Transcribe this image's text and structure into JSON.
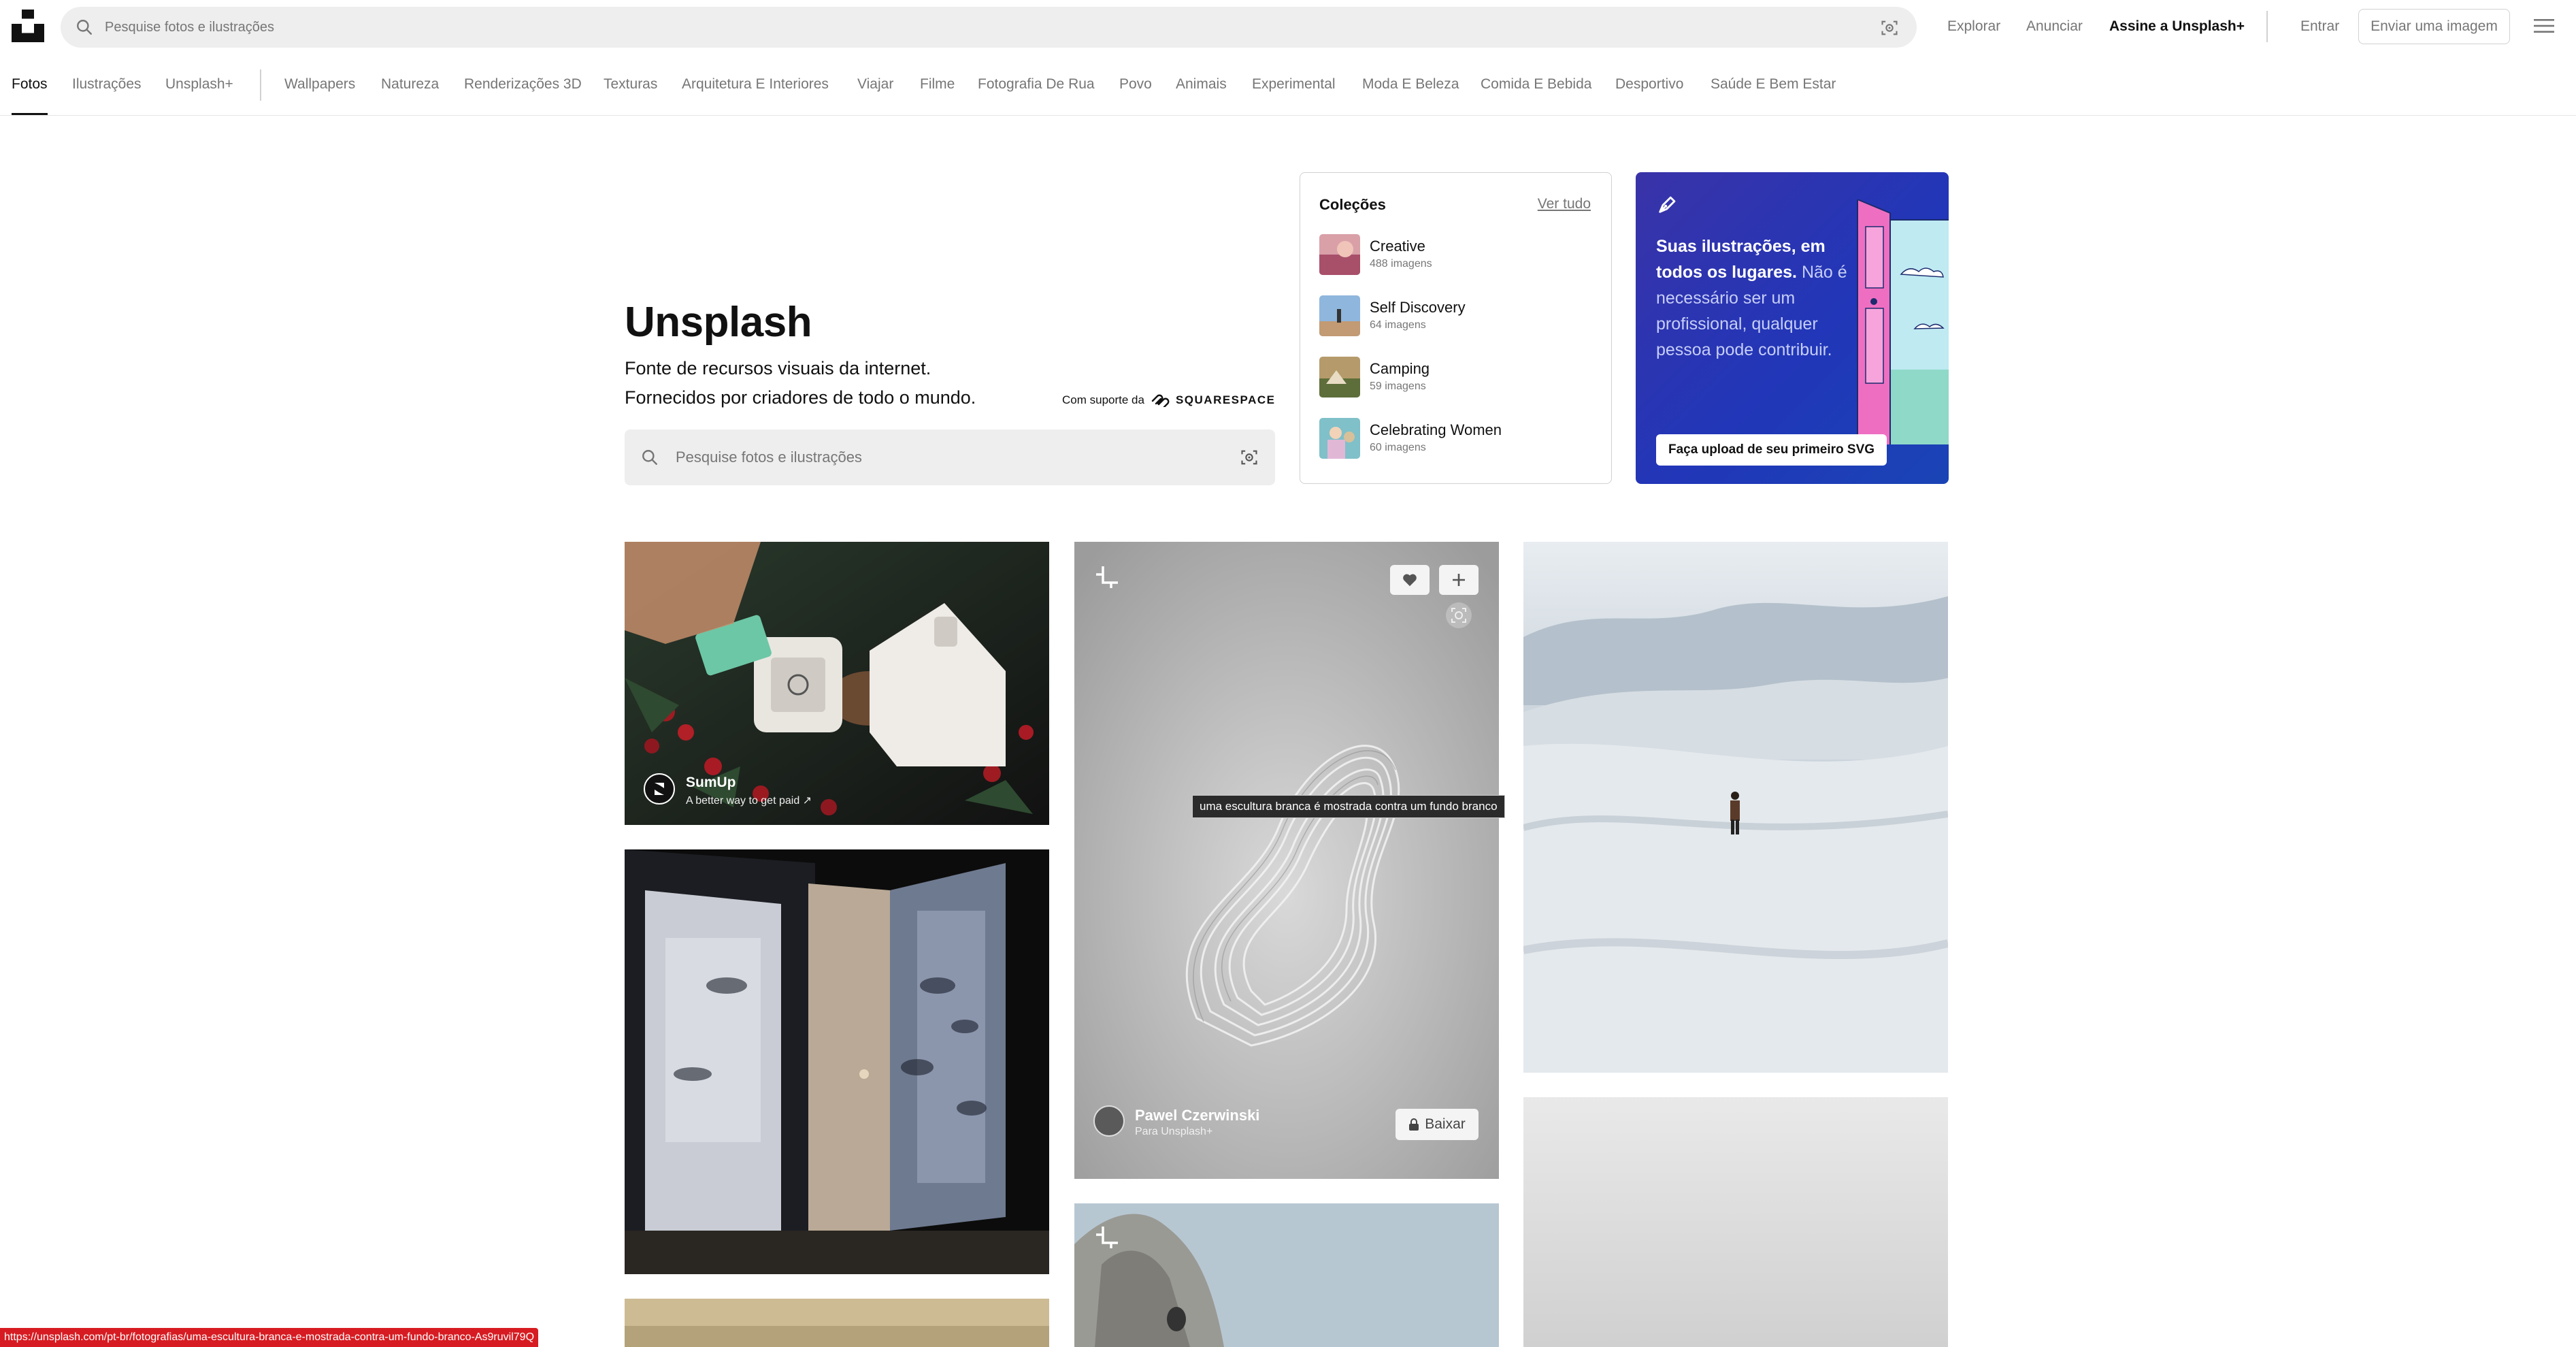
{
  "header": {
    "search_placeholder": "Pesquise fotos e ilustrações",
    "nav": {
      "explore": "Explorar",
      "advertise": "Anunciar",
      "subscribe": "Assine a Unsplash+",
      "login": "Entrar",
      "submit": "Enviar uma imagem"
    }
  },
  "categories": {
    "main": [
      "Fotos",
      "Ilustrações",
      "Unsplash+"
    ],
    "topics": [
      "Wallpapers",
      "Natureza",
      "Renderizações 3D",
      "Texturas",
      "Arquitetura E Interiores",
      "Viajar",
      "Filme",
      "Fotografia De Rua",
      "Povo",
      "Animais",
      "Experimental",
      "Moda E Beleza",
      "Comida E Bebida",
      "Desportivo",
      "Saúde E Bem Estar"
    ],
    "active": "Fotos"
  },
  "hero": {
    "title": "Unsplash",
    "line1": "Fonte de recursos visuais da internet.",
    "line2": "Fornecidos por criadores de todo o mundo.",
    "powered_by": "Com suporte da",
    "sponsor_brand": "SQUARESPACE",
    "search_placeholder": "Pesquise fotos e ilustrações"
  },
  "collections": {
    "title": "Coleções",
    "see_all": "Ver tudo",
    "items": [
      {
        "name": "Creative",
        "count": "488 imagens"
      },
      {
        "name": "Self Discovery",
        "count": "64 imagens"
      },
      {
        "name": "Camping",
        "count": "59 imagens"
      },
      {
        "name": "Celebrating Women",
        "count": "60 imagens"
      }
    ]
  },
  "promo": {
    "text_bold": "Suas ilustrações, em todos os lugares.",
    "text_rest": "Não é necessário ser um profissional, qualquer pessoa pode contribuir.",
    "button": "Faça upload de seu primeiro SVG"
  },
  "photos": {
    "sponsored": {
      "name": "SumUp",
      "tagline": "A better way to get paid ↗"
    },
    "featured": {
      "author": "Pawel Czerwinski",
      "subtitle": "Para Unsplash+",
      "download": "Baixar",
      "tooltip": "uma escultura branca é mostrada contra um fundo branco"
    }
  },
  "status_bar": {
    "url": "https://unsplash.com/pt-br/fotografias/uma-escultura-branca-e-mostrada-contra-um-fundo-branco-As9ruvil79Q"
  },
  "colors": {
    "accent_status": "#d61c22",
    "promo_bg": "#2136b8",
    "search_bg": "#eeeeee"
  }
}
